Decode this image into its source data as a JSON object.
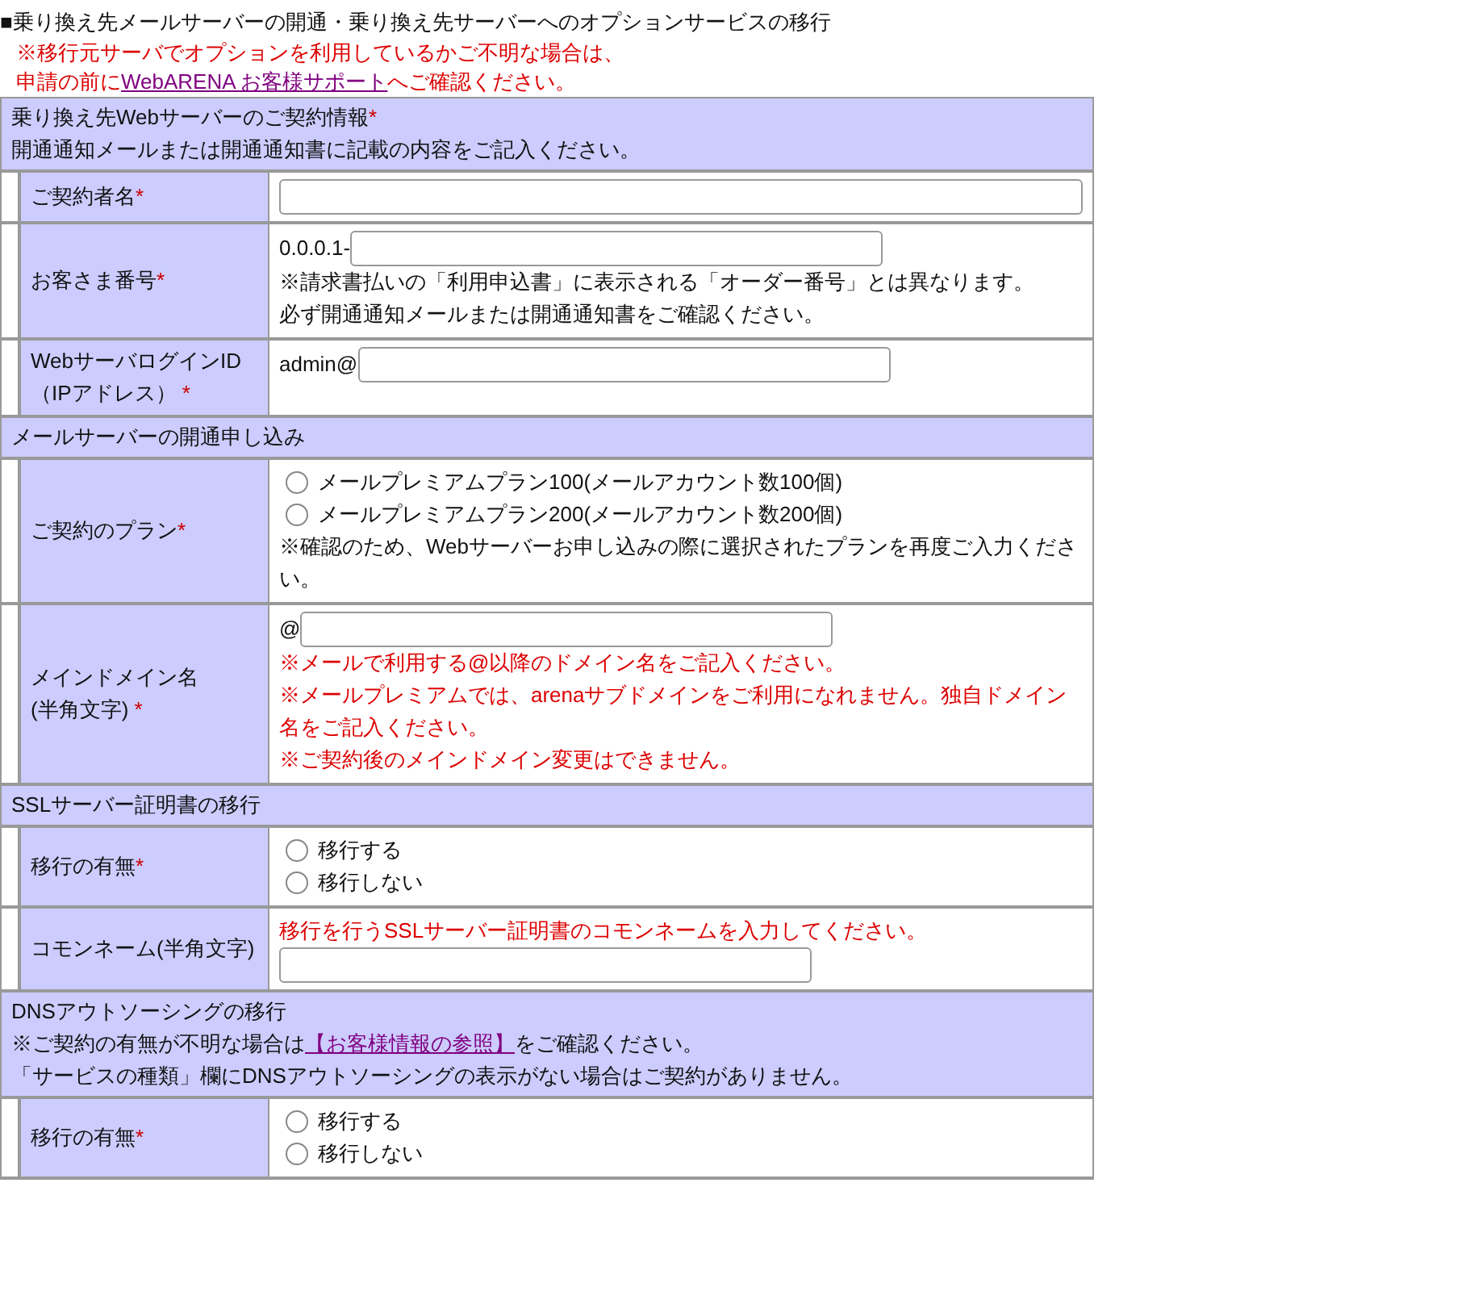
{
  "title": "■乗り換え先メールサーバーの開通・乗り換え先サーバーへのオプションサービスの移行",
  "notice": {
    "line1": "※移行元サーバでオプションを利用しているかご不明な場合は、",
    "before": "申請の前に",
    "link": "WebARENA お客様サポート",
    "after": "へご確認ください。"
  },
  "sections": [
    {
      "header": [
        {
          "text": "乗り換え先Webサーバーのご契約情報",
          "mark": "*"
        },
        {
          "text": "開通通知メールまたは開通通知書に記載の内容をご記入ください。"
        }
      ],
      "rows": [
        {
          "label": "ご契約者名",
          "mark": "*",
          "content": [
            {
              "kind": "wide_field"
            }
          ]
        },
        {
          "label": "お客さま番号",
          "mark": "*",
          "content": [
            {
              "kind": "field",
              "prefix": "0.0.0.1-"
            },
            {
              "kind": "note",
              "text": "※請求書払いの「利用申込書」に表示される「オーダー番号」とは異なります。"
            },
            {
              "kind": "note",
              "text": "必ず開通通知メールまたは開通通知書をご確認ください。"
            }
          ]
        },
        {
          "label": "WebサーバログインID",
          "label2": "（IPアドレス）",
          "mark": "*",
          "content": [
            {
              "kind": "field",
              "prefix": "admin@"
            }
          ]
        }
      ]
    },
    {
      "header": [
        {
          "text": "メールサーバーの開通申し込み"
        }
      ],
      "rows": [
        {
          "label": "ご契約のプラン",
          "mark": "*",
          "content": [
            {
              "kind": "radio",
              "text": "メールプレミアムプラン100(メールアカウント数100個)",
              "selected": false
            },
            {
              "kind": "radio",
              "text": "メールプレミアムプラン200(メールアカウント数200個)",
              "selected": false
            },
            {
              "kind": "note",
              "text": "※確認のため、Webサーバーお申し込みの際に選択されたプランを再度ご入力ください。"
            }
          ]
        },
        {
          "label": "メインドメイン名",
          "mark": "*",
          "label2": "(半角文字)",
          "content": [
            {
              "kind": "field",
              "prefix": "@"
            },
            {
              "kind": "warning",
              "text": "※メールで利用する@以降のドメイン名をご記入ください。"
            },
            {
              "kind": "warning",
              "text": "※メールプレミアムでは、arenaサブドメインをご利用になれません。独自ドメイン名をご記入ください。"
            },
            {
              "kind": "warning",
              "text": "※ご契約後のメインドメイン変更はできません。"
            }
          ]
        }
      ]
    },
    {
      "header": [
        {
          "text": "SSLサーバー証明書の移行"
        }
      ],
      "rows": [
        {
          "label": "移行の有無",
          "mark": "*",
          "content": [
            {
              "kind": "radio",
              "text": "移行する",
              "selected": false
            },
            {
              "kind": "radio",
              "text": "移行しない",
              "selected": false
            }
          ]
        },
        {
          "label": "コモンネーム(半角文字)",
          "content": [
            {
              "kind": "warning",
              "text": "移行を行うSSLサーバー証明書のコモンネームを入力してください。"
            },
            {
              "kind": "field"
            }
          ]
        }
      ]
    },
    {
      "header": [
        {
          "text": "DNSアウトソーシングの移行"
        },
        {
          "text": "※ご契約の有無が不明な場合は",
          "link": "【お客様情報の参照】",
          "after": "をご確認ください。"
        },
        {
          "text": "「サービスの種類」欄にDNSアウトソーシングの表示がない場合はご契約がありません。"
        }
      ],
      "rows": [
        {
          "label": "移行の有無",
          "mark": "*",
          "content": [
            {
              "kind": "radio",
              "text": "移行する",
              "selected": false
            },
            {
              "kind": "radio",
              "text": "移行しない",
              "selected": false
            }
          ]
        }
      ]
    }
  ]
}
